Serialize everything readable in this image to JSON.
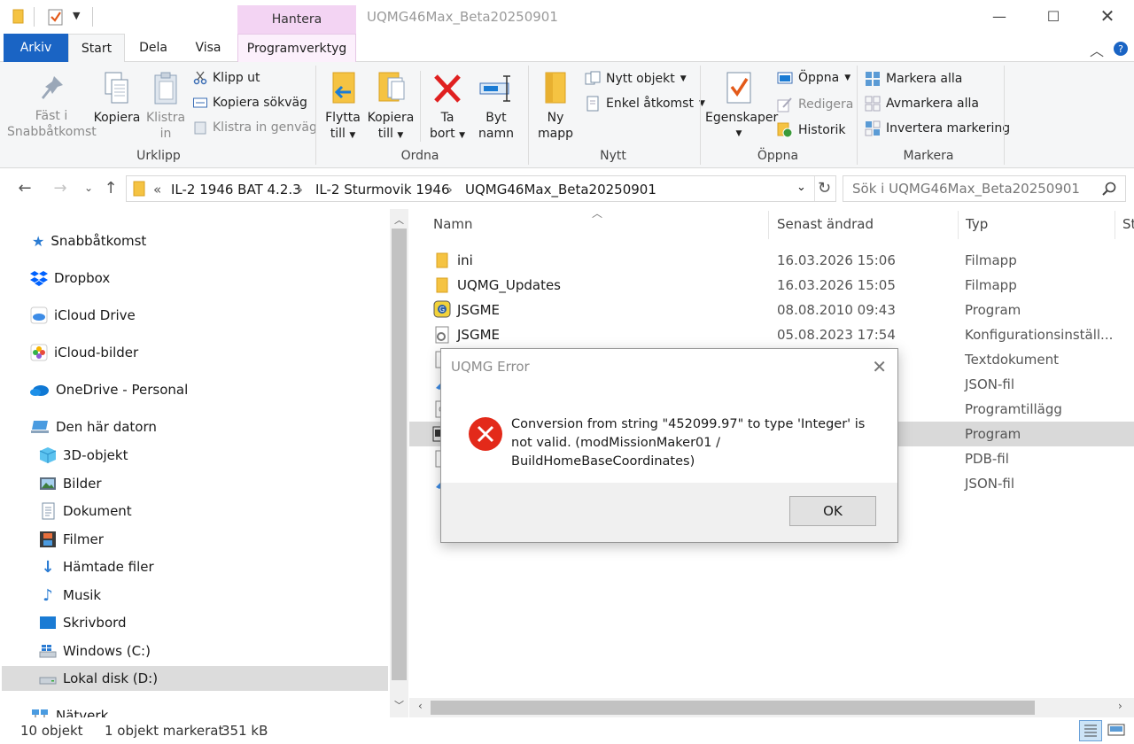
{
  "window": {
    "title": "UQMG46Max_Beta20250901",
    "context_tab": "Hantera"
  },
  "tabs": [
    "Arkiv",
    "Start",
    "Dela",
    "Visa",
    "Programverktyg"
  ],
  "ribbon": {
    "urklipp": {
      "label": "Urklipp",
      "pin": [
        "Fäst i",
        "Snabbåtkomst"
      ],
      "copy": "Kopiera",
      "paste": [
        "Klistra",
        "in"
      ],
      "cut": "Klipp ut",
      "copy_path": "Kopiera sökväg",
      "paste_shortcut": "Klistra in genväg"
    },
    "ordna": {
      "label": "Ordna",
      "move": [
        "Flytta",
        "till"
      ],
      "copy_to": [
        "Kopiera",
        "till"
      ],
      "delete": [
        "Ta",
        "bort"
      ],
      "rename": [
        "Byt",
        "namn"
      ]
    },
    "nytt": {
      "label": "Nytt",
      "new_folder": [
        "Ny",
        "mapp"
      ],
      "new_item": "Nytt objekt",
      "easy_access": "Enkel åtkomst"
    },
    "oppna": {
      "label": "Öppna",
      "properties": "Egenskaper",
      "open": "Öppna",
      "edit": "Redigera",
      "history": "Historik"
    },
    "markera": {
      "label": "Markera",
      "select_all": "Markera alla",
      "select_none": "Avmarkera alla",
      "invert": "Invertera markering"
    }
  },
  "address": {
    "overflow": "«",
    "crumbs": [
      "IL-2 1946 BAT 4.2.3",
      "IL-2 Sturmovik 1946",
      "UQMG46Max_Beta20250901"
    ],
    "search_placeholder": "Sök i UQMG46Max_Beta20250901"
  },
  "nav": {
    "quick": "Snabbåtkomst",
    "dropbox": "Dropbox",
    "icloud_drive": "iCloud Drive",
    "icloud_photos": "iCloud-bilder",
    "onedrive": "OneDrive - Personal",
    "this_pc": "Den här datorn",
    "children": [
      "3D-objekt",
      "Bilder",
      "Dokument",
      "Filmer",
      "Hämtade filer",
      "Musik",
      "Skrivbord",
      "Windows (C:)",
      "Lokal disk (D:)"
    ],
    "network": "Nätverk"
  },
  "columns": [
    "Namn",
    "Senast ändrad",
    "Typ",
    "St"
  ],
  "files": [
    {
      "name": "ini",
      "date": "16.03.2026 15:06",
      "type": "Filmapp"
    },
    {
      "name": "UQMG_Updates",
      "date": "16.03.2026 15:05",
      "type": "Filmapp"
    },
    {
      "name": "JSGME",
      "date": "08.08.2010 09:43",
      "type": "Program"
    },
    {
      "name": "JSGME",
      "date": "05.08.2023 17:54",
      "type": "Konfigurationsinställ..."
    }
  ],
  "hidden_types": [
    "Textdokument",
    "JSON-fil",
    "Programtillägg",
    "Program",
    "PDB-fil",
    "JSON-fil"
  ],
  "status": {
    "count": "10 objekt",
    "selection": "1 objekt markerat",
    "size": "351 kB"
  },
  "dialog": {
    "title": "UQMG Error",
    "message": "Conversion from string \"452099.97\" to type 'Integer' is not valid. (modMissionMaker01 / BuildHomeBaseCoordinates)",
    "ok": "OK"
  },
  "colors": {
    "accent": "#1a64c4",
    "context_tab": "#f3d4f3",
    "error_red": "#e32a1a",
    "folder": "#f5c342"
  }
}
